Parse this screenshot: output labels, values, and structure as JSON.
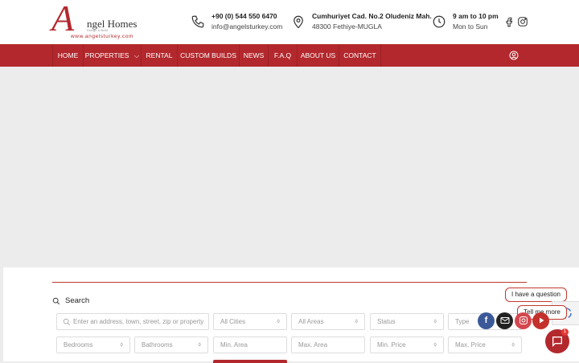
{
  "brand": {
    "initial": "A",
    "name": "ngel Homes",
    "tagline": "Design & Build",
    "url": "www.angelsturkey.com"
  },
  "contact": {
    "phone": "+90 (0) 544 550 6470",
    "email": "info@angelsturkey.com",
    "address_line1": "Cumhuriyet Cad. No.2 Oludeniz Mah.",
    "address_line2": "48300 Fethiye-MUGLA",
    "hours_line1": "9 am to 10 pm",
    "hours_line2": "Mon to Sun"
  },
  "nav": {
    "items": [
      "HOME",
      "PROPERTIES",
      "RENTAL",
      "CUSTOM BUILDS",
      "NEWS",
      "F.A.Q",
      "ABOUT US",
      "CONTACT"
    ],
    "dropdown_caret": "⌵"
  },
  "search": {
    "title": "Search",
    "keyword_placeholder": "Enter an address, town, street, zip or property ID",
    "cities": "All Cities",
    "areas": "All Areas",
    "status": "Status",
    "type": "Type",
    "bedrooms": "Bedrooms",
    "bathrooms": "Bathrooms",
    "min_area": "Min. Area",
    "max_area": "Max. Area",
    "min_price": "Min. Price",
    "max_price": "Max. Price",
    "caret": "⌃⌄"
  },
  "widgets": {
    "question": "I have a question",
    "tell_me": "Tell me more",
    "chat_badge": "1"
  },
  "colors": {
    "brand_red": "#b3282d",
    "facebook": "#3b5998",
    "youtube": "#c4302b"
  }
}
